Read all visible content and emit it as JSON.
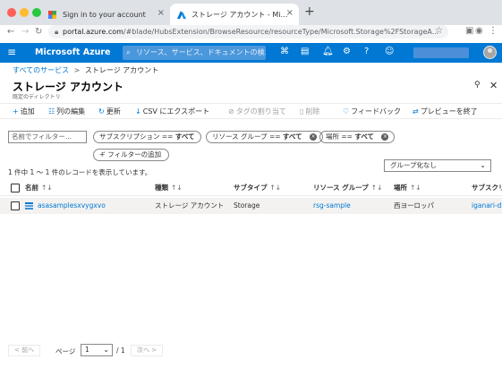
{
  "browser": {
    "tabs": [
      {
        "title": "Sign in to your account",
        "favicon": "google-favicon"
      },
      {
        "title": "ストレージ アカウント - Microsoft",
        "favicon": "azure-favicon"
      }
    ],
    "new_tab": "+",
    "url_host": "portal.azure.com",
    "url_path": "/#blade/HubsExtension/BrowseResource/resourceType/Microsoft.Storage%2FStorageA...",
    "traffic_colors": [
      "#fe5f57",
      "#febc2e",
      "#28c840"
    ]
  },
  "azure": {
    "brand": "Microsoft Azure",
    "search_placeholder": "リソース、サービス、ドキュメントの検...",
    "accent": "#0078d4"
  },
  "blade": {
    "breadcrumb_link": "すべてのサービス",
    "breadcrumb_sep": ">",
    "breadcrumb_current": "ストレージ アカウント",
    "title": "ストレージ アカウント",
    "subtitle": "既定のディレクトリ"
  },
  "toolbar": {
    "add": "追加",
    "edit_columns": "列の編集",
    "refresh": "更新",
    "export_csv": "CSV にエクスポート",
    "assign_tags": "タグの割り当て",
    "delete": "削除",
    "feedback": "フィードバック",
    "end_preview": "プレビューを終了"
  },
  "filters": {
    "name_placeholder": "名前でフィルター...",
    "subscription_label": "サブスクリプション ==",
    "subscription_value": "すべて",
    "resource_group_label": "リソース グループ ==",
    "resource_group_value": "すべて",
    "location_label": "場所 ==",
    "location_value": "すべて",
    "add_filter": "フィルターの追加"
  },
  "records": {
    "count_text": "1 件中 1 ～ 1 件のレコードを表示しています。",
    "group_by": "グループ化なし"
  },
  "table": {
    "columns": [
      "名前",
      "種類",
      "サブタイプ",
      "リソース グループ",
      "場所",
      "サブスクリ"
    ],
    "rows": [
      {
        "name": "asasamplesxvygxvo",
        "type": "ストレージ アカウント",
        "subtype": "Storage",
        "resource_group": "rsg-sample",
        "location": "西ヨーロッパ",
        "subscription": "iganari-d"
      }
    ]
  },
  "pager": {
    "prev": "< 前へ",
    "page_label": "ページ",
    "page_value": "1",
    "of_total": "/ 1",
    "next": "次へ >"
  }
}
